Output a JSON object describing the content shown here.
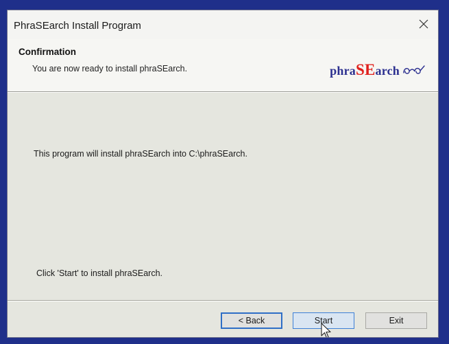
{
  "window": {
    "title": "PhraSEarch Install Program"
  },
  "header": {
    "title": "Confirmation",
    "subtitle": "You are now ready to install phraSEarch.",
    "logo": {
      "part1": "phra",
      "part2": "SE",
      "part3": "arch"
    }
  },
  "body": {
    "install_info": "This program will install phraSEarch into C:\\phraSEarch.",
    "start_hint": "Click 'Start' to install phraSEarch."
  },
  "buttons": {
    "back_label": "< Back",
    "start_label": "Start",
    "exit_label": "Exit"
  },
  "icons": {
    "close": "close-icon",
    "logo_mark": "logo-glasses-icon",
    "cursor": "mouse-pointer-icon"
  },
  "colors": {
    "desktop_bg": "#1f2f8a",
    "logo_blue": "#2b2f8f",
    "logo_red": "#e0201c",
    "focus_blue": "#2e6ec6"
  }
}
